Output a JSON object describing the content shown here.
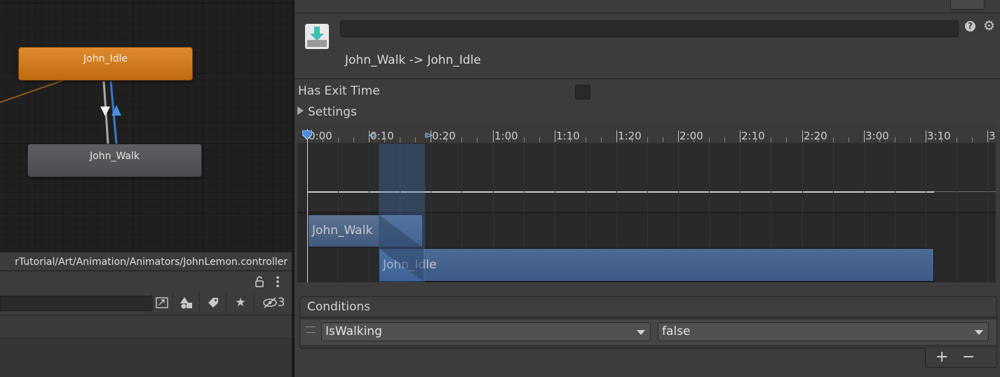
{
  "graph": {
    "nodes": {
      "idle": "John_Idle",
      "walk": "John_Walk"
    }
  },
  "path_bar": {
    "text": "rTutorial/Art/Animation/Animators/JohnLemon.controller"
  },
  "lower_left": {
    "hidden_count": "3",
    "icons": [
      "lock-icon",
      "kebab-menu-icon",
      "scene-link-icon",
      "shapes-icon",
      "tag-icon",
      "star-icon",
      "eye-hidden-icon"
    ]
  },
  "inspector": {
    "transition_title": "John_Walk -> John_Idle",
    "help_glyph": "?",
    "has_exit_time_label": "Has Exit Time",
    "has_exit_time": false,
    "settings_label": "Settings",
    "timeline": {
      "ticks": [
        "0:00",
        "0:10",
        "0:20",
        "1:00",
        "1:10",
        "1:20",
        "2:00",
        "2:10",
        "2:20",
        "3:00",
        "3:10",
        "3:"
      ],
      "clips": {
        "source": "John_Walk",
        "destination": "John_Idle"
      }
    },
    "conditions": {
      "title": "Conditions",
      "parameter": "IsWalking",
      "value": "false",
      "add_label": "+",
      "remove_label": "−"
    }
  },
  "colors": {
    "default_state": "#c9731a",
    "state": "#55575b",
    "accent_blue": "#4a6a96"
  }
}
